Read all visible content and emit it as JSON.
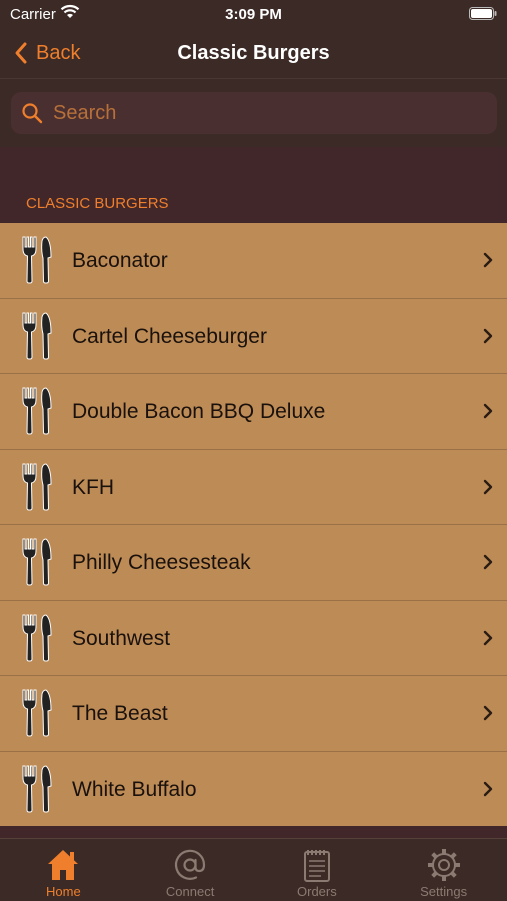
{
  "status_bar": {
    "carrier": "Carrier",
    "time": "3:09 PM"
  },
  "nav": {
    "back_label": "Back",
    "title": "Classic Burgers"
  },
  "search": {
    "placeholder": "Search"
  },
  "section": {
    "header": "CLASSIC BURGERS"
  },
  "items": [
    {
      "label": "Baconator"
    },
    {
      "label": "Cartel Cheeseburger"
    },
    {
      "label": "Double Bacon BBQ Deluxe"
    },
    {
      "label": "KFH"
    },
    {
      "label": "Philly Cheesesteak"
    },
    {
      "label": "Southwest"
    },
    {
      "label": "The Beast"
    },
    {
      "label": "White Buffalo"
    }
  ],
  "tabs": [
    {
      "label": "Home",
      "icon": "house-icon",
      "active": true
    },
    {
      "label": "Connect",
      "icon": "at-sign-icon",
      "active": false
    },
    {
      "label": "Orders",
      "icon": "notepad-icon",
      "active": false
    },
    {
      "label": "Settings",
      "icon": "gear-icon",
      "active": false
    }
  ],
  "colors": {
    "accent": "#ef7f2c",
    "background": "#42272a",
    "bar": "#3b2a26",
    "row": "#bd8b56",
    "inactive_tab": "#8b7a72"
  }
}
